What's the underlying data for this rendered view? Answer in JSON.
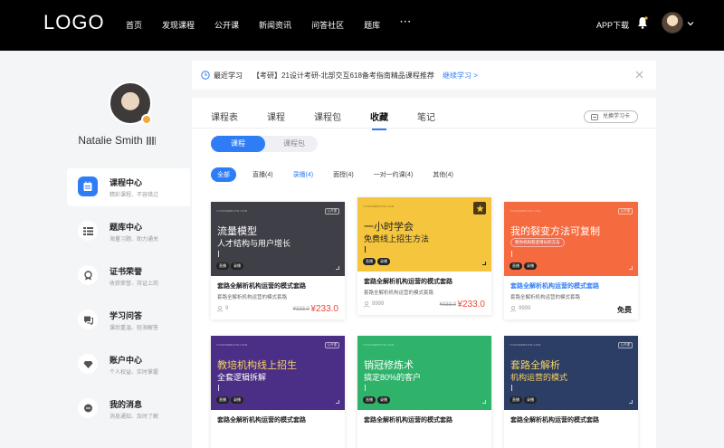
{
  "nav": {
    "logo": "LOGO",
    "items": [
      "首页",
      "发现课程",
      "公开课",
      "新闻资讯",
      "问答社区",
      "题库"
    ],
    "more": "···",
    "app_download": "APP下载"
  },
  "profile": {
    "name": "Natalie Smith"
  },
  "sidebar": {
    "items": [
      {
        "title": "课程中心",
        "desc": "精彩课程、不容错过"
      },
      {
        "title": "题库中心",
        "desc": "海量习题、助力通关"
      },
      {
        "title": "证书荣誉",
        "desc": "收获荣誉、持证上岗"
      },
      {
        "title": "学习问答",
        "desc": "课后重温、轻海解答"
      },
      {
        "title": "账户中心",
        "desc": "个人权益、实时掌握"
      },
      {
        "title": "我的消息",
        "desc": "消息通知、及时了解"
      }
    ]
  },
  "notice": {
    "label": "最近学习",
    "text": "【考研】21设计考研-北部交互618备考指南精品课程推荐",
    "link": "继续学习 >"
  },
  "tabs": [
    "课程表",
    "课程",
    "课程包",
    "收藏",
    "笔记"
  ],
  "redeem": "兑换学习卡",
  "segment": [
    "课程",
    "课程包"
  ],
  "filters": [
    "全部",
    "直播(4)",
    "录播(4)",
    "面授(4)",
    "一对一约课(4)",
    "其他(4)"
  ],
  "cards": [
    {
      "site": "YOURWEBSITE.COM",
      "tag": "公开课",
      "cover_line1": "流量模型",
      "cover_line2": "人才结构与用户增长",
      "badges": [
        "直播",
        "录播"
      ],
      "title": "套路全解析机构运营的模式套路",
      "sub": "套路全解析机构运营的模式套路",
      "count": "9",
      "old_price": "¥333.0",
      "price": "¥233.0",
      "colors": {
        "bg": "#3f3f47",
        "t1": "#ffffff",
        "t2": "#ffffff"
      }
    },
    {
      "site": "YOURWEBSITE.COM",
      "tag": "",
      "cover_line1": "一小时学会",
      "cover_line2": "免费线上招生方法",
      "badges": [
        "直播",
        "录播"
      ],
      "title": "套路全解析机构运营的模式套路",
      "sub": "套路全解析机构运营的模式套路",
      "count": "9999",
      "old_price": "¥333.0",
      "price": "¥233.0",
      "colors": {
        "bg": "#f5c63d",
        "t1": "#222222",
        "t2": "#222222"
      }
    },
    {
      "site": "YOURWEBSITE.COM",
      "tag": "公开课",
      "cover_line1": "我的裂变方法可复制",
      "cover_line2": "",
      "red_pill": "教你机构裂变增长的方法",
      "badges": [
        "直播",
        "录播"
      ],
      "title": "套路全解析机构运营的模式套路",
      "sub": "套路全解析机构运营的模式套路",
      "count": "9999",
      "free": "免费",
      "colors": {
        "bg": "#f56a3f",
        "t1": "#ffffff",
        "t2": "#ffffff"
      }
    },
    {
      "site": "YOURWEBSITE.COM",
      "tag": "公开课",
      "cover_line1": "教培机构线上招生",
      "cover_line2": "全套逻辑拆解",
      "badges": [
        "直播",
        "录播"
      ],
      "title": "套路全解析机构运营的模式套路",
      "colors": {
        "bg": "#4b2f86",
        "t1": "#f6d260",
        "t2": "#ffffff"
      }
    },
    {
      "site": "YOURWEBSITE.COM",
      "tag": "",
      "cover_line1": "销冠修炼术",
      "cover_line2": "搞定80%的客户",
      "badges": [
        "直播",
        "录播"
      ],
      "title": "套路全解析机构运营的模式套路",
      "colors": {
        "bg": "#2fb36b",
        "t1": "#ffffff",
        "t2": "#ffffff"
      }
    },
    {
      "site": "YOURWEBSITE.COM",
      "tag": "公开课",
      "cover_line1": "套路全解析",
      "cover_line2": "机构运营的模式",
      "badges": [
        "直播",
        "录播"
      ],
      "title": "套路全解析机构运营的模式套路",
      "colors": {
        "bg": "#2c3e66",
        "t1": "#f6d260",
        "t2": "#f6d260"
      }
    }
  ]
}
